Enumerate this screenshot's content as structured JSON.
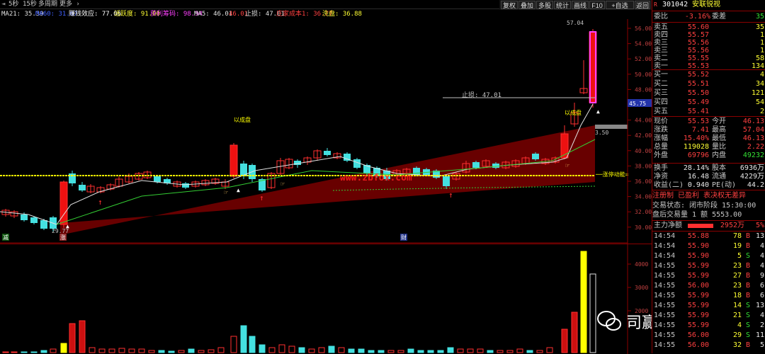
{
  "topbar": {
    "period_icon": "◄",
    "tabs": [
      "5秒",
      "15秒",
      "多周期",
      "更多 ›"
    ]
  },
  "toolbar": {
    "buttons": [
      "复权",
      "叠加",
      "多股",
      "统计",
      "画线",
      "F10",
      "+自选",
      "返回"
    ]
  },
  "indicators": [
    {
      "label": "MA21: 35.39",
      "color": "#e0e0e0"
    },
    {
      "label": "MA60: 31.67",
      "color": "#4060ff"
    },
    {
      "label": "赚钱效应: 77.06",
      "color": "#ffffff"
    },
    {
      "label": "活跃度: 91.00",
      "color": "#ffff33"
    },
    {
      "label": "获利筹码: 98.94",
      "color": "#ff40ff"
    },
    {
      "label": "MA5: 46.01",
      "color": "#e0e0e0"
    },
    {
      "label": "46.01",
      "color": "#ff4040"
    },
    {
      "label": "止损: 47.01",
      "color": "#e0e0e0"
    },
    {
      "label": "庄家成本1: 36.77",
      "color": "#ff4040"
    },
    {
      "label": "洗盘: 36.88",
      "color": "#ffff33"
    }
  ],
  "chart": {
    "price_axis": [
      "56.00",
      "54.00",
      "52.00",
      "50.00",
      "48.00",
      "46.00",
      "44.00",
      "42.00",
      "40.00",
      "38.00",
      "36.00",
      "34.00",
      "32.00",
      "30.00"
    ],
    "current_price_tag": "45.75",
    "high_label": "57.04",
    "low_label": "29.77",
    "stop_loss_label": "止损: 47.01",
    "dial_label": "3.50",
    "zhuli_label": "──涨停动能=",
    "qi_label_1": "以成盘",
    "qi_label_2": "以成盘",
    "watermark_text": "www.zbfox.com",
    "jian_label": "减",
    "zhang_label": "涨",
    "cai_label": "财",
    "colors": {
      "up": "#ff3030",
      "down": "#44e0e0",
      "band": "#8b0000",
      "yellow": "#ffff00"
    }
  },
  "volume": {
    "axis": [
      "4000",
      "3000",
      "2000"
    ]
  },
  "watermark": {
    "text": "司赢空指标所"
  },
  "quote": {
    "code": "301042",
    "name": "安联锐视",
    "weibi_label": "委比",
    "weibi": "-3.16%",
    "weicha_label": "委差",
    "weicha": "35",
    "asks": [
      {
        "label": "卖五",
        "price": "55.60",
        "vol": "35"
      },
      {
        "label": "卖四",
        "price": "55.57",
        "vol": "1"
      },
      {
        "label": "卖三",
        "price": "55.56",
        "vol": "1"
      },
      {
        "label": "卖三",
        "price": "55.56",
        "vol": "1"
      },
      {
        "label": "卖二",
        "price": "55.55",
        "vol": "58"
      },
      {
        "label": "卖一",
        "price": "55.53",
        "vol": "134"
      }
    ],
    "bids": [
      {
        "label": "买一",
        "price": "55.52",
        "vol": "4"
      },
      {
        "label": "买二",
        "price": "55.51",
        "vol": "34"
      },
      {
        "label": "买三",
        "price": "55.50",
        "vol": "121"
      },
      {
        "label": "买四",
        "price": "55.49",
        "vol": "54"
      },
      {
        "label": "买五",
        "price": "55.41",
        "vol": "2"
      }
    ],
    "stats": [
      {
        "l1": "现价",
        "v1": "55.53",
        "c1": "red",
        "l2": "今开",
        "v2": "46.13",
        "c2": "red"
      },
      {
        "l1": "涨跌",
        "v1": "7.41",
        "c1": "red",
        "l2": "最高",
        "v2": "57.04",
        "c2": "red"
      },
      {
        "l1": "涨幅",
        "v1": "15.40%",
        "c1": "red",
        "l2": "最低",
        "v2": "46.13",
        "c2": "red"
      },
      {
        "l1": "总量",
        "v1": "119028",
        "c1": "yellow",
        "l2": "量比",
        "v2": "2.22",
        "c2": "red"
      },
      {
        "l1": "外盘",
        "v1": "69796",
        "c1": "red",
        "l2": "内盘",
        "v2": "49232",
        "c2": "green"
      }
    ],
    "stats2": [
      {
        "l1": "换手",
        "v1": "28.14%",
        "l2": "股本",
        "v2": "6936万"
      },
      {
        "l1": "净资",
        "v1": "16.48",
        "l2": "流通",
        "v2": "4229万"
      },
      {
        "l1": "收益(二)",
        "v1": "0.940",
        "l2": "PE(动)",
        "v2": "44.2"
      }
    ],
    "notice": "注册制 已盈利 表决权无差异",
    "trade_state": "交易状态: 闭市阶段 15:30:00",
    "after_hours": "盘后交易量 1 额 5553.00",
    "main_flow_label": "主力净额",
    "main_flow_value": "2952万",
    "main_flow_pct": "5%",
    "ticks": [
      {
        "t": "14:54",
        "p": "55.88",
        "v": "78",
        "s": "B",
        "n": "13"
      },
      {
        "t": "14:54",
        "p": "55.90",
        "v": "19",
        "s": "B",
        "n": "4"
      },
      {
        "t": "14:54",
        "p": "55.90",
        "v": "5",
        "s": "S",
        "n": "4"
      },
      {
        "t": "14:55",
        "p": "55.99",
        "v": "23",
        "s": "B",
        "n": "4"
      },
      {
        "t": "14:55",
        "p": "55.99",
        "v": "27",
        "s": "B",
        "n": "9"
      },
      {
        "t": "14:55",
        "p": "56.00",
        "v": "23",
        "s": "B",
        "n": "6"
      },
      {
        "t": "14:55",
        "p": "55.99",
        "v": "18",
        "s": "B",
        "n": "6"
      },
      {
        "t": "14:55",
        "p": "55.99",
        "v": "14",
        "s": "S",
        "n": "13"
      },
      {
        "t": "14:55",
        "p": "55.99",
        "v": "21",
        "s": "S",
        "n": "4"
      },
      {
        "t": "14:55",
        "p": "55.99",
        "v": "4",
        "s": "S",
        "n": "2"
      },
      {
        "t": "14:55",
        "p": "56.00",
        "v": "29",
        "s": "S",
        "n": "11"
      },
      {
        "t": "14:55",
        "p": "56.00",
        "v": "32",
        "s": "B",
        "n": "5"
      }
    ]
  }
}
